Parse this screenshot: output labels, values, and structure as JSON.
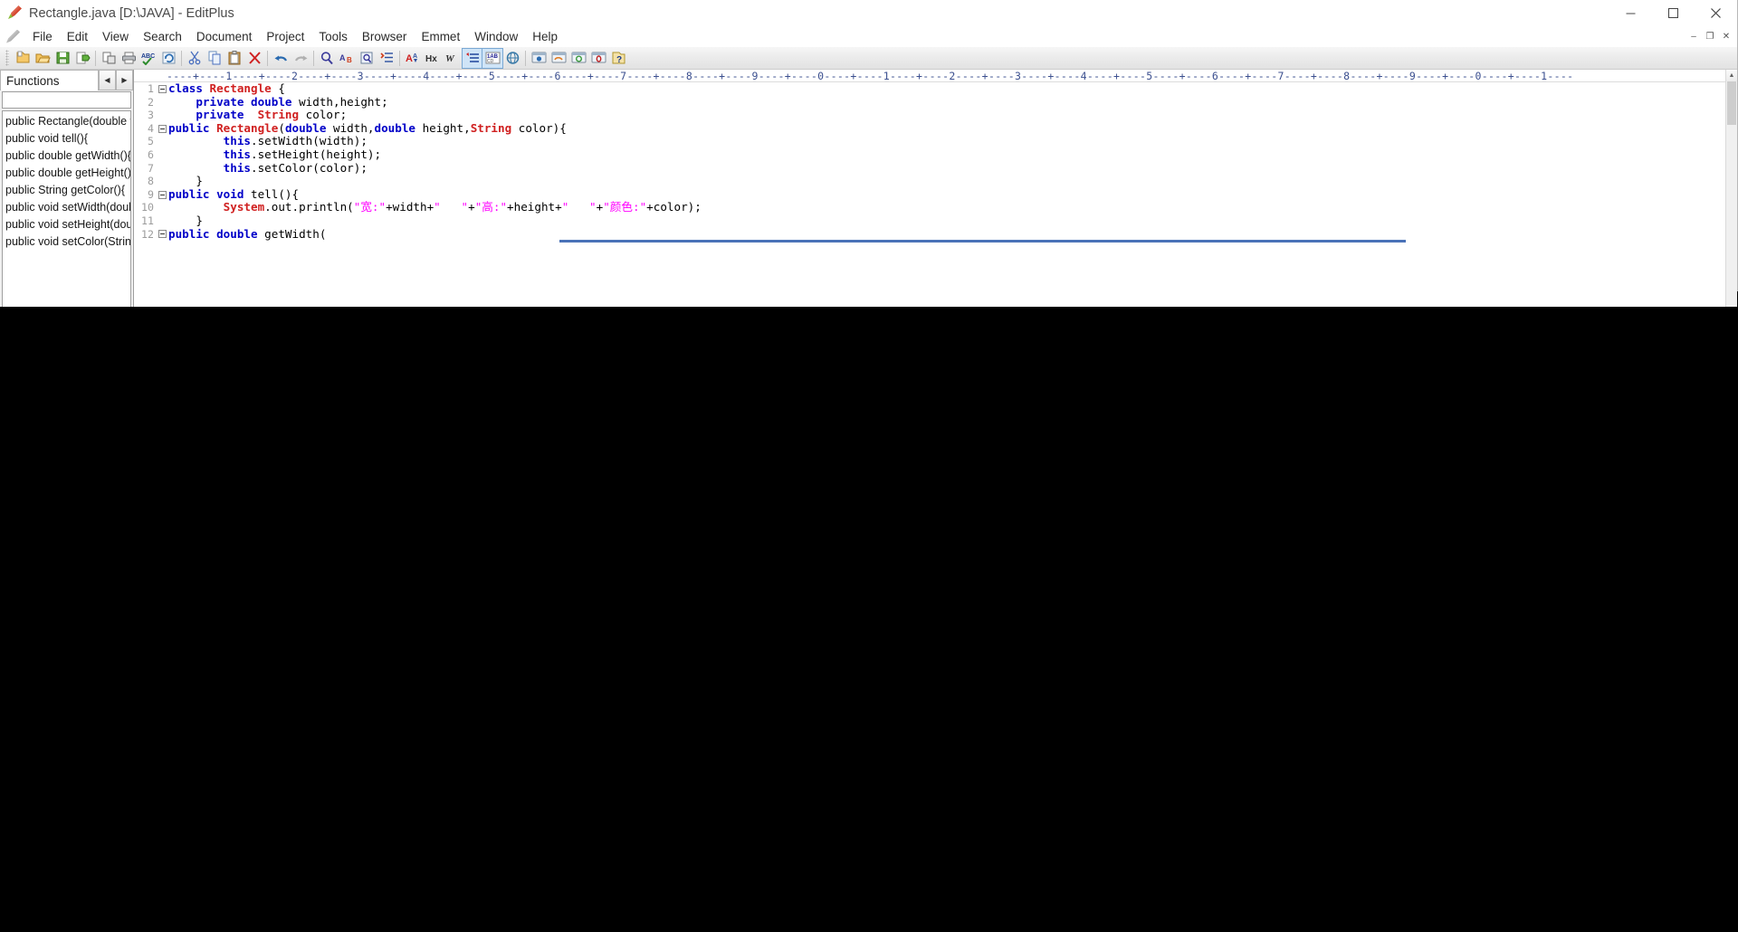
{
  "window": {
    "title": "Rectangle.java [D:\\JAVA] - EditPlus",
    "icon": "editplus-pencil-icon",
    "minimize_label": "Minimize",
    "maximize_label": "Maximize",
    "close_label": "Close"
  },
  "menubar": {
    "app_icon": "pencil-icon",
    "items": [
      {
        "label": "File"
      },
      {
        "label": "Edit"
      },
      {
        "label": "View"
      },
      {
        "label": "Search"
      },
      {
        "label": "Document"
      },
      {
        "label": "Project"
      },
      {
        "label": "Tools"
      },
      {
        "label": "Browser"
      },
      {
        "label": "Emmet"
      },
      {
        "label": "Window"
      },
      {
        "label": "Help"
      }
    ],
    "doc_minimize": "–",
    "doc_restore": "❐",
    "doc_close": "✕"
  },
  "toolbar": {
    "groups": [
      [
        "new-file-icon",
        "open-file-icon",
        "save-icon",
        "save-as-icon"
      ],
      [
        "print-preview-icon",
        "print-icon",
        "spellcheck-icon",
        "reload-icon"
      ],
      [
        "cut-icon",
        "copy-icon",
        "paste-icon",
        "delete-icon"
      ],
      [
        "undo-icon",
        "redo-icon"
      ],
      [
        "find-icon",
        "replace-icon",
        "find-in-files-icon",
        "goto-line-icon"
      ],
      [
        "change-case-icon",
        "hex-view-icon",
        "word-wrap-icon",
        "line-numbers-icon",
        "ascii-table-icon",
        "preview-icon"
      ],
      [
        "browser-ie-icon",
        "browser-firefox-icon",
        "browser-chrome-icon",
        "browser-opera-icon",
        "help-icon"
      ]
    ]
  },
  "sidebar": {
    "tab_label": "Functions",
    "nav_prev": "◀",
    "nav_next": "▶",
    "search_value": "",
    "search_placeholder": "",
    "items": [
      {
        "label": "public Rectangle(double wid"
      },
      {
        "label": "public void tell(){"
      },
      {
        "label": "public double getWidth(){"
      },
      {
        "label": "public double getHeight(){"
      },
      {
        "label": "public String getColor(){"
      },
      {
        "label": "public void setWidth(double"
      },
      {
        "label": "public void setHeight(doub"
      },
      {
        "label": "public void setColor(Strin"
      }
    ]
  },
  "editor": {
    "ruler": "----+----1----+----2----+----3----+----4----+----5----+----6----+----7----+----8----+----9----+----0----+----1----+----2----+----3----+----4----+----5----+----6----+----7----+----8----+----9----+----0----+----1----",
    "lines": [
      {
        "num": "1",
        "fold": true,
        "indent": 0,
        "tokens": [
          {
            "c": "k",
            "t": "class"
          },
          {
            "c": "p",
            "t": " "
          },
          {
            "c": "t",
            "t": "Rectangle"
          },
          {
            "c": "p",
            "t": " {"
          }
        ]
      },
      {
        "num": "2",
        "fold": false,
        "indent": 0,
        "tokens": [
          {
            "c": "p",
            "t": "    "
          },
          {
            "c": "k",
            "t": "private"
          },
          {
            "c": "p",
            "t": " "
          },
          {
            "c": "k",
            "t": "double"
          },
          {
            "c": "p",
            "t": " width,height;"
          }
        ]
      },
      {
        "num": "3",
        "fold": false,
        "indent": 0,
        "tokens": [
          {
            "c": "p",
            "t": "    "
          },
          {
            "c": "k",
            "t": "private"
          },
          {
            "c": "p",
            "t": "  "
          },
          {
            "c": "t",
            "t": "String"
          },
          {
            "c": "p",
            "t": " color;"
          }
        ]
      },
      {
        "num": "4",
        "fold": true,
        "indent": 0,
        "tokens": [
          {
            "c": "k",
            "t": "public"
          },
          {
            "c": "p",
            "t": " "
          },
          {
            "c": "t",
            "t": "Rectangle"
          },
          {
            "c": "p",
            "t": "("
          },
          {
            "c": "k",
            "t": "double"
          },
          {
            "c": "p",
            "t": " width,"
          },
          {
            "c": "k",
            "t": "double"
          },
          {
            "c": "p",
            "t": " height,"
          },
          {
            "c": "t",
            "t": "String"
          },
          {
            "c": "p",
            "t": " color){"
          }
        ]
      },
      {
        "num": "5",
        "fold": false,
        "indent": 0,
        "tokens": [
          {
            "c": "p",
            "t": "        "
          },
          {
            "c": "k",
            "t": "this"
          },
          {
            "c": "p",
            "t": ".setWidth(width);"
          }
        ]
      },
      {
        "num": "6",
        "fold": false,
        "indent": 0,
        "tokens": [
          {
            "c": "p",
            "t": "        "
          },
          {
            "c": "k",
            "t": "this"
          },
          {
            "c": "p",
            "t": ".setHeight(height);"
          }
        ]
      },
      {
        "num": "7",
        "fold": false,
        "indent": 0,
        "tokens": [
          {
            "c": "p",
            "t": "        "
          },
          {
            "c": "k",
            "t": "this"
          },
          {
            "c": "p",
            "t": ".setColor(color);"
          }
        ]
      },
      {
        "num": "8",
        "fold": false,
        "indent": 0,
        "tokens": [
          {
            "c": "p",
            "t": "    }"
          }
        ]
      },
      {
        "num": "9",
        "fold": true,
        "indent": 0,
        "tokens": [
          {
            "c": "k",
            "t": "public"
          },
          {
            "c": "p",
            "t": " "
          },
          {
            "c": "k",
            "t": "void"
          },
          {
            "c": "p",
            "t": " tell(){"
          }
        ]
      },
      {
        "num": "10",
        "fold": false,
        "indent": 0,
        "tokens": [
          {
            "c": "p",
            "t": "        "
          },
          {
            "c": "t",
            "t": "System"
          },
          {
            "c": "p",
            "t": ".out.println("
          },
          {
            "c": "s",
            "t": "\"宽:\""
          },
          {
            "c": "p",
            "t": "+width+"
          },
          {
            "c": "s",
            "t": "\"   \""
          },
          {
            "c": "p",
            "t": "+"
          },
          {
            "c": "s",
            "t": "\"高:\""
          },
          {
            "c": "p",
            "t": "+height+"
          },
          {
            "c": "s",
            "t": "\"   \""
          },
          {
            "c": "p",
            "t": "+"
          },
          {
            "c": "s",
            "t": "\"颜色:\""
          },
          {
            "c": "p",
            "t": "+color);"
          }
        ]
      },
      {
        "num": "11",
        "fold": false,
        "indent": 0,
        "tokens": [
          {
            "c": "p",
            "t": "    }"
          }
        ]
      },
      {
        "num": "12",
        "fold": true,
        "indent": 0,
        "tokens": [
          {
            "c": "k",
            "t": "public"
          },
          {
            "c": "p",
            "t": " "
          },
          {
            "c": "k",
            "t": "double"
          },
          {
            "c": "p",
            "t": " getWidth("
          }
        ]
      }
    ],
    "vscroll_up": "▲",
    "vscroll_down": "▼"
  },
  "colors": {
    "keyword": "#0000c8",
    "type": "#d02020",
    "string": "#ff00ff",
    "linenumber": "#9c9c9c",
    "ruler": "#3b4f8f",
    "hscroll": "#4a72b8",
    "desktop": "#000000"
  }
}
